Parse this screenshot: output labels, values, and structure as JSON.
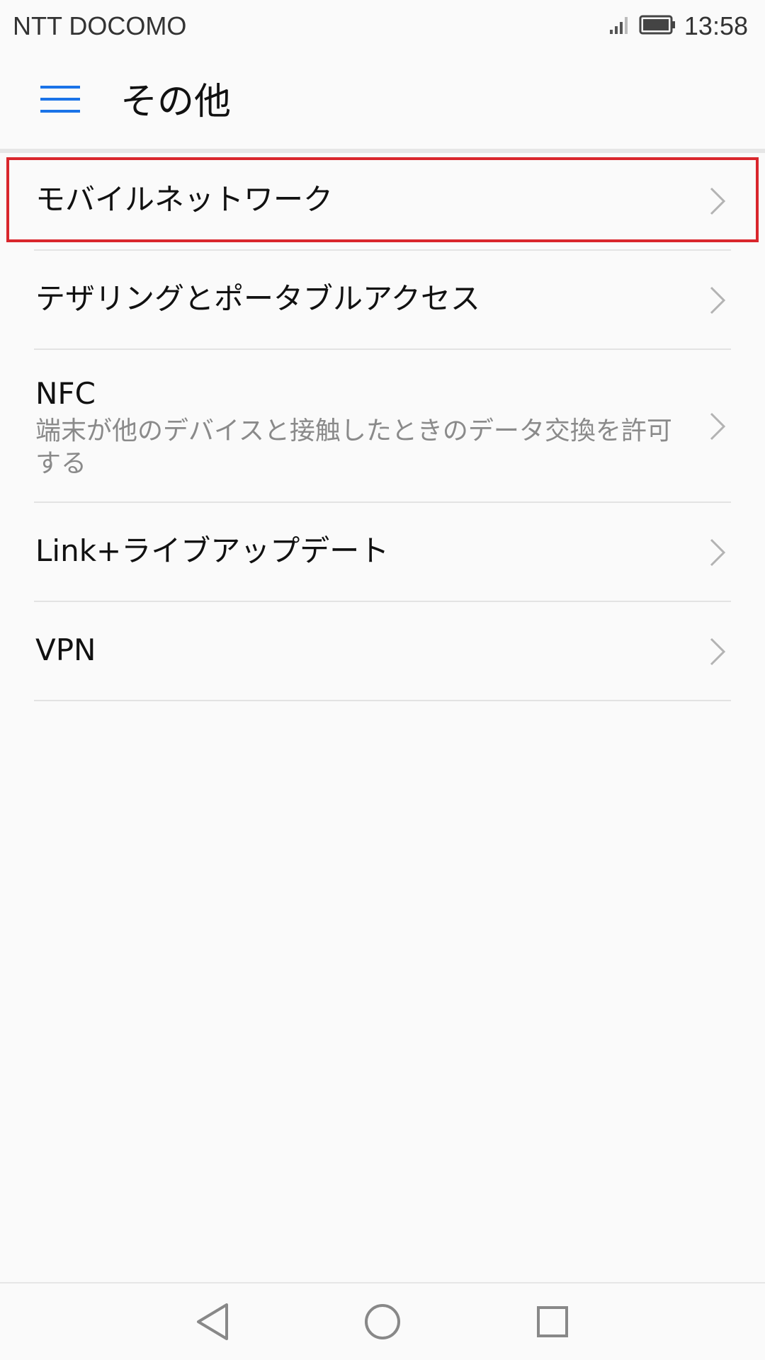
{
  "status_bar": {
    "carrier": "NTT DOCOMO",
    "time": "13:58",
    "icons": [
      "signal-icon",
      "battery-icon"
    ]
  },
  "app_bar": {
    "title": "その他",
    "menu_icon": "hamburger-menu-icon",
    "accent_color": "#1a73e8"
  },
  "list": {
    "items": [
      {
        "title": "モバイルネットワーク",
        "subtitle": "",
        "icon": "chevron-right-icon",
        "highlighted": true
      },
      {
        "title": "テザリングとポータブルアクセス",
        "subtitle": "",
        "icon": "chevron-right-icon"
      },
      {
        "title": "NFC",
        "subtitle": "端末が他のデバイスと接触したときのデータ交換を許可する",
        "icon": "chevron-right-icon"
      },
      {
        "title": "Link+ライブアップデート",
        "subtitle": "",
        "icon": "chevron-right-icon"
      },
      {
        "title": "VPN",
        "subtitle": "",
        "icon": "chevron-right-icon"
      }
    ]
  },
  "highlight_color": "#d9262c",
  "nav_bar": {
    "buttons": [
      "back-icon",
      "home-icon",
      "recents-icon"
    ]
  }
}
